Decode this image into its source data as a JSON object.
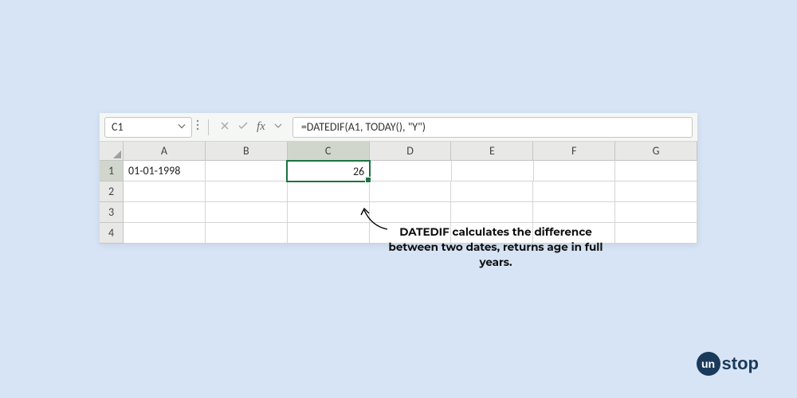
{
  "formula_bar": {
    "cell_reference": "C1",
    "formula": "=DATEDIF(A1, TODAY(), \"Y\")"
  },
  "columns": [
    "A",
    "B",
    "C",
    "D",
    "E",
    "F",
    "G"
  ],
  "rows": [
    "1",
    "2",
    "3",
    "4"
  ],
  "cells": {
    "A1": "01-01-1998",
    "C1": "26"
  },
  "selected_cell": "C1",
  "annotation": {
    "text": "DATEDIF calculates the difference between two dates, returns age in full years."
  },
  "logo": {
    "circle": "un",
    "rest": "stop"
  }
}
